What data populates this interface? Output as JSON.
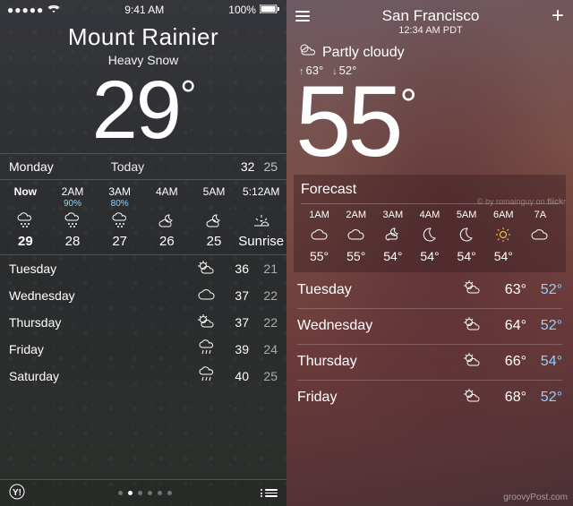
{
  "left": {
    "status": {
      "carrier_dots": "●●●●●",
      "wifi": "wifi",
      "time": "9:41 AM",
      "battery_pct": "100%"
    },
    "city": "Mount Rainier",
    "condition": "Heavy Snow",
    "temp": "29",
    "today": {
      "day": "Monday",
      "label": "Today",
      "high": "32",
      "low": "25"
    },
    "hourly": [
      {
        "time": "Now",
        "pop": "",
        "icon": "snow",
        "temp": "29"
      },
      {
        "time": "2AM",
        "pop": "90%",
        "icon": "snow",
        "temp": "28"
      },
      {
        "time": "3AM",
        "pop": "80%",
        "icon": "snow",
        "temp": "27"
      },
      {
        "time": "4AM",
        "pop": "",
        "icon": "cloud-night",
        "temp": "26"
      },
      {
        "time": "5AM",
        "pop": "",
        "icon": "cloud-night",
        "temp": "25"
      },
      {
        "time": "5:12AM",
        "pop": "",
        "icon": "sunrise",
        "temp": "Sunrise"
      }
    ],
    "daily": [
      {
        "day": "Tuesday",
        "icon": "partly-sunny",
        "high": "36",
        "low": "21"
      },
      {
        "day": "Wednesday",
        "icon": "cloud",
        "high": "37",
        "low": "22"
      },
      {
        "day": "Thursday",
        "icon": "partly-sunny",
        "high": "37",
        "low": "22"
      },
      {
        "day": "Friday",
        "icon": "rain",
        "high": "39",
        "low": "24"
      },
      {
        "day": "Saturday",
        "icon": "rain",
        "high": "40",
        "low": "25"
      }
    ],
    "footer": {
      "provider": "Yahoo!",
      "pages": 6,
      "active_page": 1
    }
  },
  "right": {
    "city": "San Francisco",
    "subtitle": "12:34 AM PDT",
    "summary": {
      "condition": "Partly cloudy",
      "high": "63°",
      "low": "52°"
    },
    "temp": "55",
    "credit": "© by romainguy on flickr",
    "forecast_label": "Forecast",
    "hourly": [
      {
        "time": "1AM",
        "icon": "cloud",
        "temp": "55°"
      },
      {
        "time": "2AM",
        "icon": "cloud",
        "temp": "55°"
      },
      {
        "time": "3AM",
        "icon": "moon-cloud",
        "temp": "54°"
      },
      {
        "time": "4AM",
        "icon": "moon",
        "temp": "54°"
      },
      {
        "time": "5AM",
        "icon": "moon",
        "temp": "54°"
      },
      {
        "time": "6AM",
        "icon": "sun",
        "temp": "54°"
      },
      {
        "time": "7A",
        "icon": "cloud",
        "temp": ""
      }
    ],
    "daily": [
      {
        "day": "Tuesday",
        "icon": "partly-cloudy",
        "high": "63°",
        "low": "52°"
      },
      {
        "day": "Wednesday",
        "icon": "partly-cloudy",
        "high": "64°",
        "low": "52°"
      },
      {
        "day": "Thursday",
        "icon": "partly-cloudy",
        "high": "66°",
        "low": "54°"
      },
      {
        "day": "Friday",
        "icon": "partly-cloudy",
        "high": "68°",
        "low": "52°"
      }
    ],
    "watermark": "groovyPost.com"
  }
}
